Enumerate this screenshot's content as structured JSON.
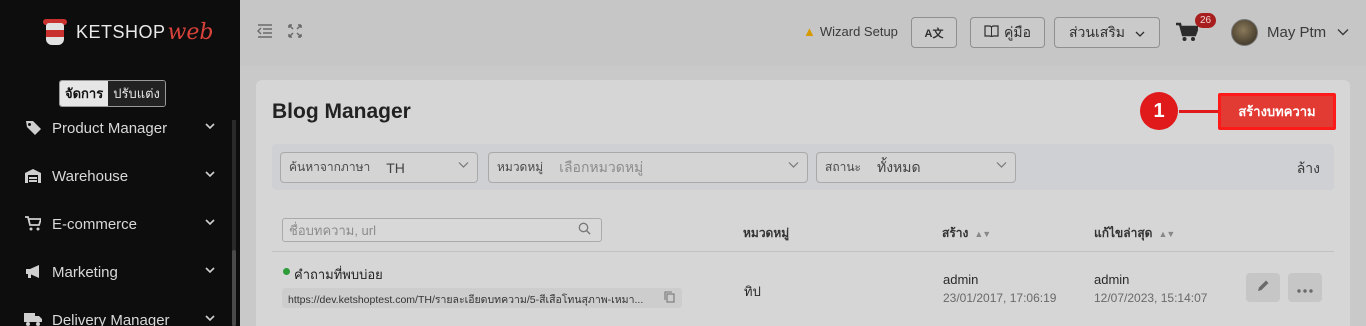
{
  "app": {
    "logo_text": "KETSHOP",
    "logo_web": "web"
  },
  "sidebar": {
    "mode_active": "จัดการ",
    "mode_inactive": "ปรับแต่ง",
    "items": [
      {
        "label": "Product Manager",
        "icon": "tag-icon"
      },
      {
        "label": "Warehouse",
        "icon": "warehouse-icon"
      },
      {
        "label": "E-commerce",
        "icon": "cart-icon"
      },
      {
        "label": "Marketing",
        "icon": "megaphone-icon"
      },
      {
        "label": "Delivery Manager",
        "icon": "truck-icon"
      }
    ]
  },
  "header": {
    "wizard_label": "Wizard Setup",
    "translate_label": "A文",
    "manual_label": "คู่มือ",
    "addons_label": "ส่วนเสริม",
    "cart_count": "26",
    "user_name": "May Ptm"
  },
  "page": {
    "title": "Blog Manager",
    "create_button": "สร้างบทความ",
    "callout_number": "1"
  },
  "filters": {
    "language_label": "ค้นหาจากภาษา",
    "language_value": "TH",
    "category_label": "หมวดหมู่",
    "category_placeholder": "เลือกหมวดหมู่",
    "status_label": "สถานะ",
    "status_value": "ทั้งหมด",
    "clear_label": "ล้าง"
  },
  "table": {
    "search_placeholder": "ชื่อบทความ, url",
    "columns": {
      "category": "หมวดหมู่",
      "created": "สร้าง",
      "updated": "แก้ไขล่าสุด"
    },
    "rows": [
      {
        "title": "คำถามที่พบบ่อย",
        "url": "https://dev.ketshoptest.com/TH/รายละเอียดบทความ/5-สีเสือโทนสุภาพ-เหมา...",
        "category": "ทิป",
        "created_by": "admin",
        "created_at": "23/01/2017, 17:06:19",
        "updated_by": "admin",
        "updated_at": "12/07/2023, 15:14:07",
        "status_color": "#2e9c3a"
      }
    ]
  }
}
